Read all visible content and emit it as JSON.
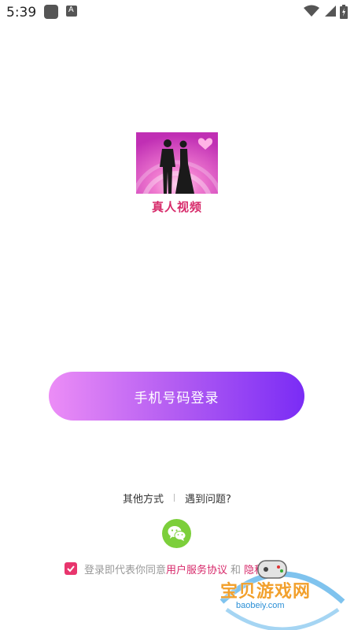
{
  "status_bar": {
    "time": "5:39",
    "icons": [
      "square-notification-icon",
      "a-notification-icon",
      "wifi-icon",
      "signal-icon",
      "battery-icon"
    ]
  },
  "logo": {
    "title": "真人视频",
    "colors": {
      "background": "#e85bc3",
      "text": "#d72a6a"
    }
  },
  "login": {
    "phone_button_label": "手机号码登录",
    "colors": {
      "gradient_start": "#ec8df6",
      "gradient_end": "#7a2cf5"
    }
  },
  "options": {
    "other_methods": "其他方式",
    "help": "遇到问题?"
  },
  "wechat": {
    "icon": "wechat-icon",
    "color": "#7ccf3b"
  },
  "agreement": {
    "checked": true,
    "prefix": "登录即代表你同意",
    "user_agreement": "用户服务协议",
    "and": "和",
    "privacy": "隐私政策",
    "accent_color": "#d7296a"
  },
  "watermark": {
    "title": "宝贝游戏网",
    "url": "baobeiy.com"
  }
}
